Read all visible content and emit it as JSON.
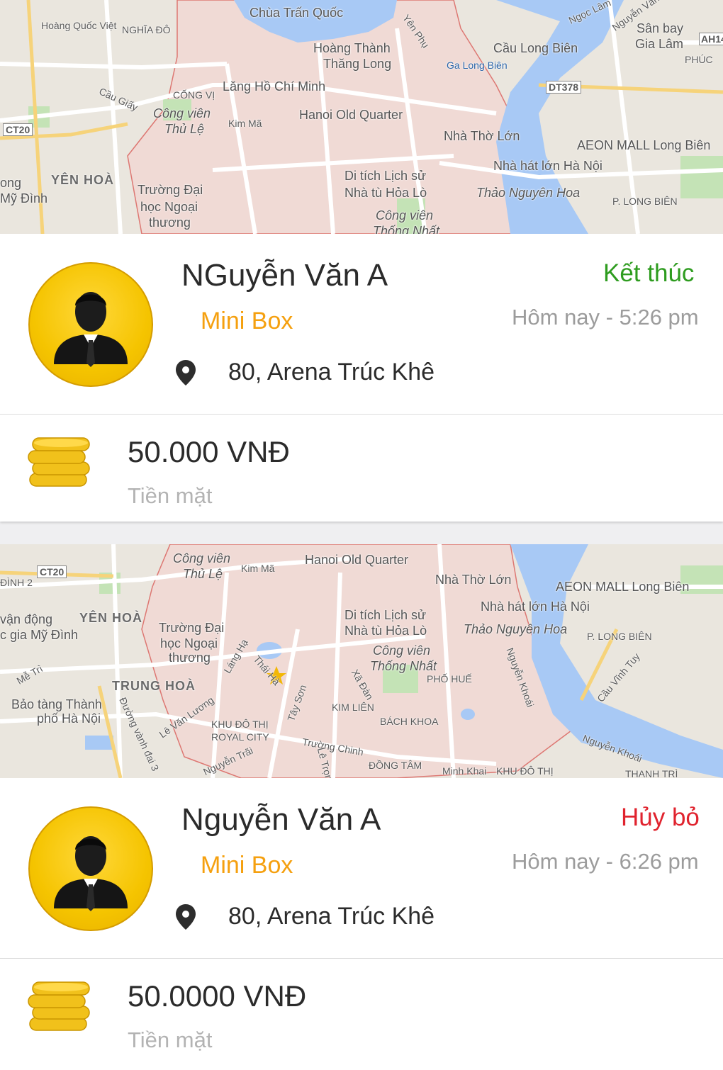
{
  "trips": [
    {
      "map_labels": {
        "chua_tran_quoc": "Chùa Trấn Quốc",
        "hoang_quoc_viet": "Hoàng Quốc Việt",
        "nghia_do": "NGHĨA ĐÔ",
        "hoang_thanh": "Hoàng Thành",
        "thang_long": "Thăng Long",
        "cau_long_bien": "Cầu Long Biên",
        "ga_long_bien": "Ga Long Biên",
        "san_bay": "Sân bay",
        "gia_lam": "Gia Lâm",
        "lang_hcm": "Lăng Hồ Chí Minh",
        "cong_vi": "CỐNG VỊ",
        "cau_giay": "Cầu Giấy",
        "cong_vien_thu_le_1": "Công viên",
        "cong_vien_thu_le_2": "Thủ Lệ",
        "kim_ma": "Kim Mã",
        "hanoi_old_quarter": "Hanoi Old Quarter",
        "nha_tho_lon": "Nhà Thờ Lớn",
        "ct20": "CT20",
        "dt378": "DT378",
        "aeon": "AEON MALL Long Biên",
        "yen_hoa": "YÊN HOÀ",
        "truong_dai_1": "Trường Đại",
        "truong_dai_2": "học Ngoại",
        "truong_dai_3": "thương",
        "di_tich_1": "Di tích Lịch sử",
        "di_tich_2": "Nhà tù Hỏa Lò",
        "nha_hat_lon": "Nhà hát lớn Hà Nội",
        "thao_nguyen_hoa": "Thảo Nguyên Hoa",
        "p_long_bien": "P. LONG BIÊN",
        "cong_vien_thong_nhat_1": "Công viên",
        "cong_vien_thong_nhat_2": "Thống Nhất",
        "ong": "ong",
        "my_dinh": "Mỹ Đình",
        "ah14": "AH14",
        "phuc": "PHÚC",
        "yen_phu": "Yên Phụ",
        "ngoc_lam": "Ngọc Lâm",
        "nguyen_van": "Nguyễn Văn"
      },
      "driver_name": "NGuyễn Văn A",
      "service": "Mini Box",
      "status": "Kết thúc",
      "status_color": "#2e9c1f",
      "time": "Hôm nay - 5:26 pm",
      "address": "80, Arena Trúc Khê",
      "price": "50.000 VNĐ",
      "payment": "Tiền mặt"
    },
    {
      "map_labels": {
        "cong_vien_thu_le_1": "Công viên",
        "cong_vien_thu_le_2": "Thủ Lệ",
        "kim_ma": "Kim Mã",
        "hanoi_old_quarter": "Hanoi Old Quarter",
        "nha_tho_lon": "Nhà Thờ Lớn",
        "ct20": "CT20",
        "dinh_2": "ĐÌNH 2",
        "aeon": "AEON MALL Long Biên",
        "van_dong": "vận động",
        "gia_my_dinh": "c gia Mỹ Đình",
        "yen_hoa": "YÊN HOÀ",
        "truong_dai_1": "Trường Đại",
        "truong_dai_2": "học Ngoại",
        "truong_dai_3": "thương",
        "di_tich_1": "Di tích Lịch sử",
        "di_tich_2": "Nhà tù Hỏa Lò",
        "nha_hat_lon": "Nhà hát lớn Hà Nội",
        "thao_nguyen_hoa": "Thảo Nguyên Hoa",
        "p_long_bien": "P. LONG BIÊN",
        "cong_vien_thong_nhat_1": "Công viên",
        "cong_vien_thong_nhat_2": "Thống Nhất",
        "pho_hue": "PHỐ HUẾ",
        "trung_hoa": "TRUNG HOÀ",
        "bao_tang_1": "Bảo tàng Thành",
        "bao_tang_2": "phố Hà Nội",
        "kim_lien": "KIM LIÊN",
        "bach_khoa": "BÁCH KHOA",
        "khu_do_thi_1": "KHU ĐÔ THỊ",
        "khu_do_thi_2": "ROYAL CITY",
        "dong_tam": "ĐỒNG TÂM",
        "khu_do_thi_3": "KHU ĐÔ THỊ",
        "thanh_tri": "THANH TRÌ",
        "cau_vinh_tuy": "Cầu Vĩnh Tuy",
        "nguyen_khoai": "Nguyễn Khoái",
        "truong_chinh": "Trường Chinh",
        "minh_khai": "Minh Khai",
        "me_tri": "Mễ Trì",
        "le_van_luong": "Lê Văn Lương",
        "duong_vanh_dai": "Đường vành đai 3",
        "lang_ha": "Láng Hạ",
        "tay_son": "Tây Sơn",
        "xa_dan": "Xã Đàn",
        "thai_ha": "Thái Hà",
        "le_trong": "Lê Trọng",
        "nguyen_trai": "Nguyễn Trãi",
        "nguyen_khoai_2": "Nguyễn Khoái"
      },
      "driver_name": "Nguyễn Văn A",
      "service": "Mini Box",
      "status": "Hủy bỏ",
      "status_color": "#e0232e",
      "time": "Hôm nay - 6:26 pm",
      "address": "80, Arena Trúc Khê",
      "price": "50.0000 VNĐ",
      "payment": "Tiền mặt"
    }
  ]
}
